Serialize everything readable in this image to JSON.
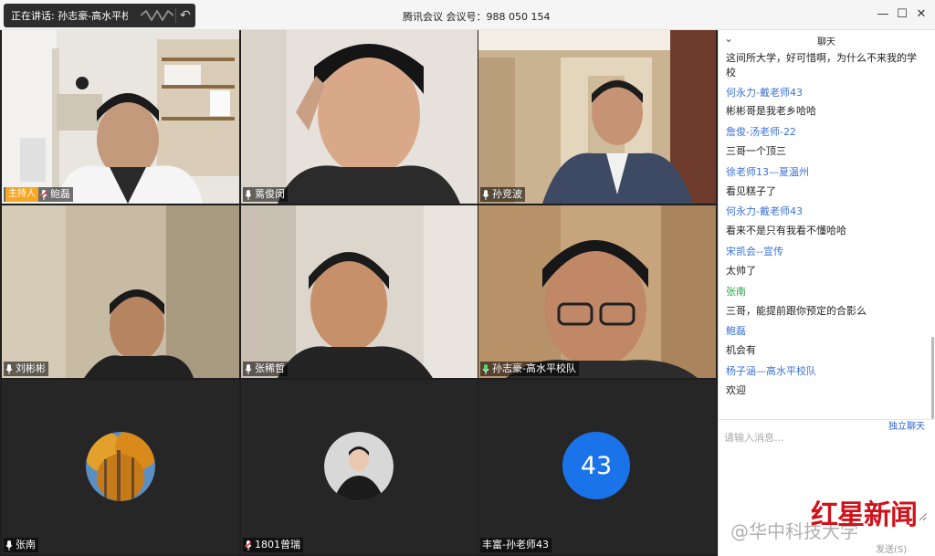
{
  "titlebar": {
    "speaking_label": "正在讲话: 孙志豪-高水平校队;",
    "meeting_title": "腾讯会议 会议号：988 050 154",
    "minimize": "—",
    "maximize": "☐",
    "close": "✕"
  },
  "tiles": [
    {
      "name": "鲍磊",
      "host": true,
      "host_label": "主持人"
    },
    {
      "name": "蔫俊闵"
    },
    {
      "name": "孙竞波"
    },
    {
      "name": "刘彬彬"
    },
    {
      "name": "张稀哲"
    },
    {
      "name": "孙志豪-高水平校队"
    },
    {
      "name": "张南"
    },
    {
      "name": "1801曾瑞"
    },
    {
      "name": "丰富-孙老师43",
      "avatar_text": "43"
    }
  ],
  "chat": {
    "title": "聊天",
    "messages": [
      {
        "type": "body",
        "text": "这间所大学，好可惜啊，为什么不来我的学"
      },
      {
        "type": "body",
        "text": "校"
      },
      {
        "type": "sender",
        "text": "何永力-戴老师43"
      },
      {
        "type": "body",
        "text": "彬彬哥是我老乡哈哈"
      },
      {
        "type": "sender",
        "text": "詹俊-汤老师-22"
      },
      {
        "type": "body",
        "text": "三哥一个顶三"
      },
      {
        "type": "sender",
        "text": "徐老师13—夏温州"
      },
      {
        "type": "body",
        "text": "看见糕子了"
      },
      {
        "type": "sender",
        "text": "何永力-戴老师43"
      },
      {
        "type": "body",
        "text": "看来不是只有我看不懂哈哈"
      },
      {
        "type": "sender",
        "text": "宋凯会--宣传"
      },
      {
        "type": "body",
        "text": "太帅了"
      },
      {
        "type": "sender-green",
        "text": "张南"
      },
      {
        "type": "body",
        "text": "三哥，能提前跟你预定的合影么"
      },
      {
        "type": "sender",
        "text": "鲍磊"
      },
      {
        "type": "body",
        "text": "机会有"
      },
      {
        "type": "sender",
        "text": "杨子涵—高水平校队"
      },
      {
        "type": "body",
        "text": "欢迎"
      }
    ],
    "popout_label": "独立聊天",
    "input_placeholder": "请输入消息...",
    "send_label": "发送(S)"
  },
  "watermarks": {
    "weibo": "@华中科技大学",
    "brand": "红星新闻"
  },
  "colors": {
    "host_tag": "#f5a623",
    "sender": "#3a72d6",
    "sender_green": "#2aa746",
    "avatar_43": "#1a73e8",
    "brand_red": "#d0121b"
  }
}
